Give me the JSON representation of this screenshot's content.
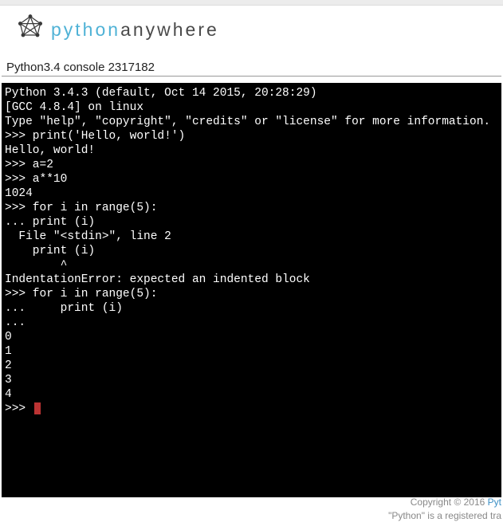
{
  "brand": {
    "part1": "python",
    "part2": "anywhere"
  },
  "console_title": "Python3.4 console 2317182",
  "terminal": {
    "lines": [
      "Python 3.4.3 (default, Oct 14 2015, 20:28:29)",
      "[GCC 4.8.4] on linux",
      "Type \"help\", \"copyright\", \"credits\" or \"license\" for more information.",
      ">>> print('Hello, world!')",
      "Hello, world!",
      ">>> a=2",
      ">>> a**10",
      "1024",
      ">>> for i in range(5):",
      "... print (i)",
      "  File \"<stdin>\", line 2",
      "    print (i)",
      "        ^",
      "IndentationError: expected an indented block",
      ">>> for i in range(5):",
      "...     print (i)",
      "...",
      "0",
      "1",
      "2",
      "3",
      "4",
      ">>> "
    ]
  },
  "footer": {
    "copyright_prefix": "Copyright © 2016 ",
    "copyright_link": "Pyt",
    "trademark": "\"Python\" is a registered tra"
  }
}
